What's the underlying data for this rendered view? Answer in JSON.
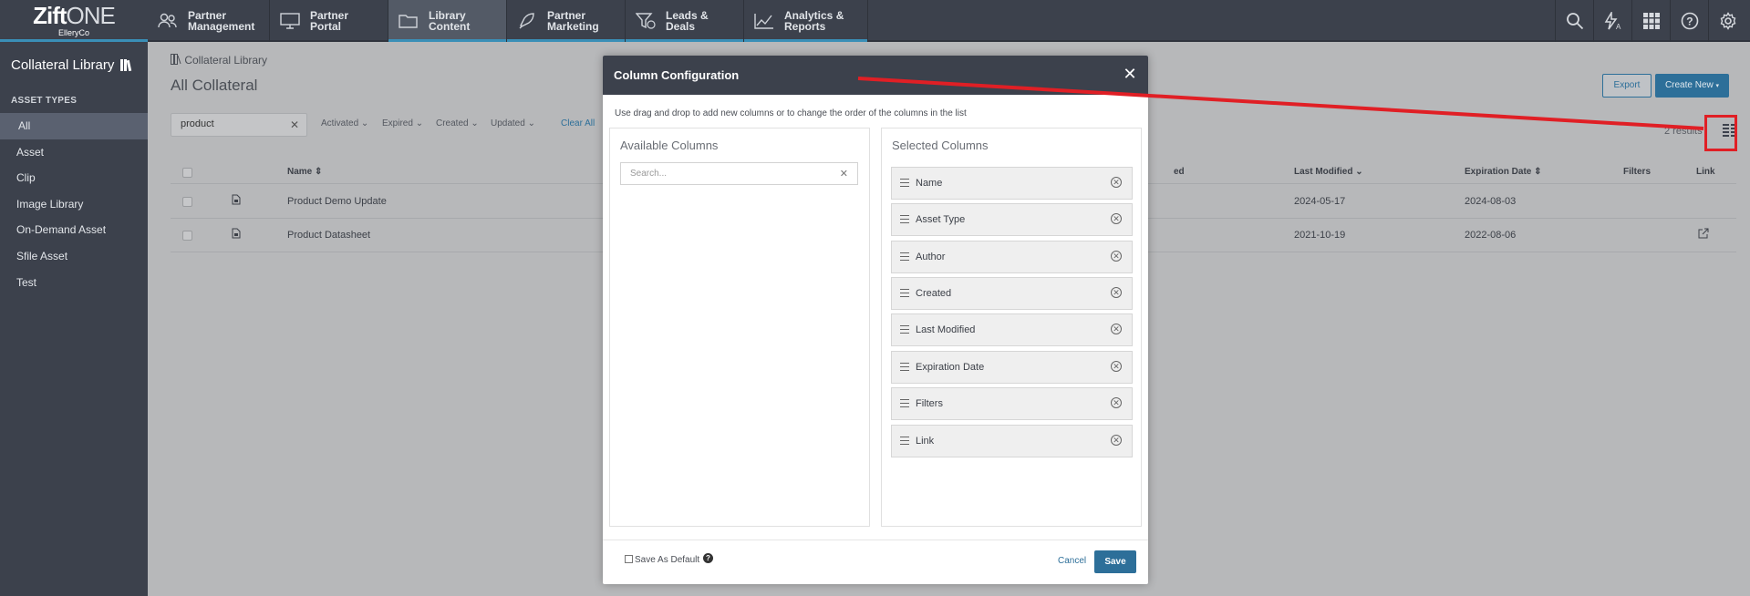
{
  "app": {
    "brand_main": "Zift",
    "brand_sub": "ONE",
    "org": "ElleryCo"
  },
  "nav": {
    "tabs": [
      {
        "line1": "Partner",
        "line2": "Management",
        "icon": "users-icon"
      },
      {
        "line1": "Partner",
        "line2": "Portal",
        "icon": "monitor-icon"
      },
      {
        "line1": "Library",
        "line2": "Content",
        "icon": "folder-icon",
        "active": true
      },
      {
        "line1": "Partner",
        "line2": "Marketing",
        "icon": "rocket-icon"
      },
      {
        "line1": "Leads &",
        "line2": "Deals",
        "icon": "funnel-dollar-icon"
      },
      {
        "line1": "Analytics &",
        "line2": "Reports",
        "icon": "line-chart-icon"
      }
    ],
    "right_icons": [
      "search-icon",
      "lightning-a-icon",
      "grid-icon",
      "help-icon",
      "gear-icon"
    ]
  },
  "sidebar": {
    "title": "Collateral Library",
    "section": "ASSET TYPES",
    "items": [
      {
        "label": "All",
        "active": true
      },
      {
        "label": "Asset"
      },
      {
        "label": "Clip"
      },
      {
        "label": "Image Library"
      },
      {
        "label": "On-Demand Asset"
      },
      {
        "label": "Sfile Asset"
      },
      {
        "label": "Test"
      }
    ]
  },
  "main": {
    "breadcrumb": "Collateral Library",
    "title": "All Collateral",
    "search_value": "product",
    "filters": [
      "Activated",
      "Expired",
      "Created",
      "Updated"
    ],
    "clear_all": "Clear All",
    "export_label": "Export",
    "create_label": "Create New",
    "results": "2 results",
    "columns": [
      "Name",
      "ed",
      "Last Modified",
      "Expiration Date",
      "Filters",
      "Link"
    ],
    "rows": [
      {
        "name": "Product Demo Update",
        "last_modified": "2024-05-17",
        "expiration": "2024-08-03",
        "link": false
      },
      {
        "name": "Product Datasheet",
        "last_modified": "2021-10-19",
        "expiration": "2022-08-06",
        "link": true
      }
    ]
  },
  "modal": {
    "title": "Column Configuration",
    "description": "Use drag and drop to add new columns or to change the order of the columns in the list",
    "available_title": "Available Columns",
    "search_placeholder": "Search...",
    "selected_title": "Selected Columns",
    "selected": [
      "Name",
      "Asset Type",
      "Author",
      "Created",
      "Last Modified",
      "Expiration Date",
      "Filters",
      "Link"
    ],
    "save_default_label": "Save As Default",
    "cancel_label": "Cancel",
    "save_label": "Save"
  },
  "colors": {
    "accent": "#2d6f99",
    "nav_bg": "#3c414c",
    "annotation": "#e01f25"
  }
}
